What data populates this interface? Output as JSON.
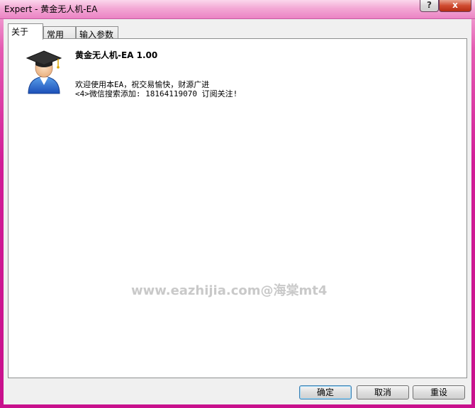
{
  "window": {
    "title": "Expert - 黄金无人机-EA",
    "help_glyph": "?",
    "close_glyph": "x"
  },
  "tabs": [
    {
      "label": "关于",
      "active": true
    },
    {
      "label": "常用",
      "active": false
    },
    {
      "label": "输入参数",
      "active": false
    }
  ],
  "about": {
    "ea_title": "黄金无人机-EA 1.00",
    "description_line1": "欢迎使用本EA，祝交易愉快，财源广进",
    "description_line2": "<4>微信搜索添加: 18164119070  订阅关注!",
    "watermark": "www.eazhijia.com@海棠mt4",
    "avatar_icon": "graduate-avatar-icon"
  },
  "buttons": {
    "ok": "确定",
    "cancel": "取消",
    "reset": "重设"
  },
  "colors": {
    "frame": "#ce0a8e",
    "close_button": "#c7432a",
    "client": "#f0f0f0"
  }
}
